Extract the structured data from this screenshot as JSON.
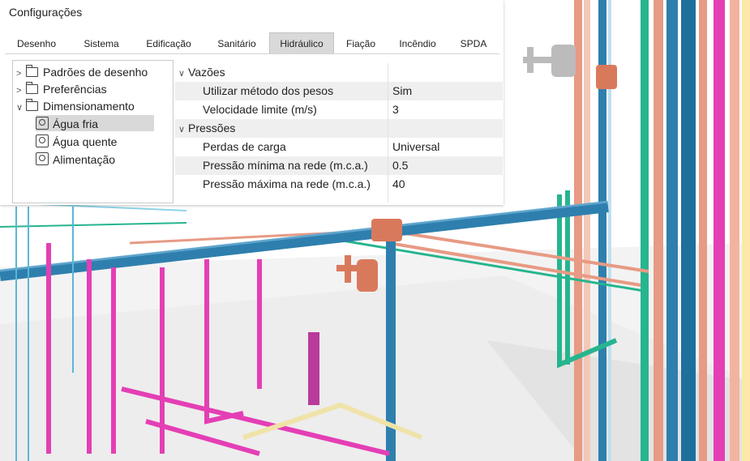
{
  "window": {
    "title": "Configurações"
  },
  "tabs": [
    {
      "label": "Desenho"
    },
    {
      "label": "Sistema"
    },
    {
      "label": "Edificação"
    },
    {
      "label": "Sanitário"
    },
    {
      "label": "Hidráulico",
      "active": true
    },
    {
      "label": "Fiação"
    },
    {
      "label": "Incêndio"
    },
    {
      "label": "SPDA"
    }
  ],
  "tree": {
    "padroes": "Padrões de desenho",
    "preferencias": "Preferências",
    "dimensionamento": "Dimensionamento",
    "agua_fria": "Água fria",
    "agua_quente": "Água quente",
    "alimentacao": "Alimentação"
  },
  "properties": {
    "vazoes": {
      "header": "Vazões",
      "metodo_label": "Utilizar método dos pesos",
      "metodo_value": "Sim",
      "velocidade_label": "Velocidade limite (m/s)",
      "velocidade_value": "3"
    },
    "pressoes": {
      "header": "Pressões",
      "perdas_label": "Perdas de carga",
      "perdas_value": "Universal",
      "minima_label": "Pressão mínima na rede (m.c.a.)",
      "minima_value": "0.5",
      "maxima_label": "Pressão máxima na rede (m.c.a.)",
      "maxima_value": "40"
    }
  },
  "colors": {
    "cold_water_pipe": "#2e7fae",
    "hot_water_pipe": "#e79a84",
    "green_pipe": "#26b58e",
    "magenta_pipe": "#e43fb5",
    "valve": "#d9795c"
  }
}
